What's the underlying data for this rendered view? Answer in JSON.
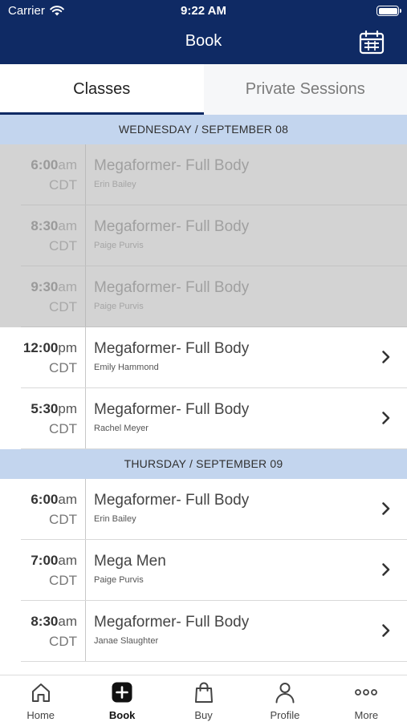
{
  "status_bar": {
    "carrier": "Carrier",
    "time": "9:22 AM"
  },
  "navbar": {
    "title": "Book"
  },
  "tabs": [
    {
      "label": "Classes",
      "active": true
    },
    {
      "label": "Private Sessions",
      "active": false
    }
  ],
  "days": [
    {
      "header": "WEDNESDAY / SEPTEMBER 08",
      "classes": [
        {
          "time": "6:00",
          "ampm": "am",
          "tz": "CDT",
          "name": "Megaformer- Full Body",
          "instructor": "Erin Bailey",
          "past": true
        },
        {
          "time": "8:30",
          "ampm": "am",
          "tz": "CDT",
          "name": "Megaformer- Full Body",
          "instructor": "Paige Purvis",
          "past": true
        },
        {
          "time": "9:30",
          "ampm": "am",
          "tz": "CDT",
          "name": "Megaformer- Full Body",
          "instructor": "Paige Purvis",
          "past": true
        },
        {
          "time": "12:00",
          "ampm": "pm",
          "tz": "CDT",
          "name": "Megaformer- Full Body",
          "instructor": "Emily Hammond",
          "past": false
        },
        {
          "time": "5:30",
          "ampm": "pm",
          "tz": "CDT",
          "name": "Megaformer- Full Body",
          "instructor": "Rachel Meyer",
          "past": false
        }
      ]
    },
    {
      "header": "THURSDAY / SEPTEMBER 09",
      "classes": [
        {
          "time": "6:00",
          "ampm": "am",
          "tz": "CDT",
          "name": "Megaformer- Full Body",
          "instructor": "Erin Bailey",
          "past": false
        },
        {
          "time": "7:00",
          "ampm": "am",
          "tz": "CDT",
          "name": "Mega Men",
          "instructor": "Paige Purvis",
          "past": false
        },
        {
          "time": "8:30",
          "ampm": "am",
          "tz": "CDT",
          "name": "Megaformer- Full Body",
          "instructor": "Janae Slaughter",
          "past": false
        }
      ]
    }
  ],
  "tabbar": [
    {
      "label": "Home",
      "icon": "home-icon",
      "active": false
    },
    {
      "label": "Book",
      "icon": "book-plus-icon",
      "active": true
    },
    {
      "label": "Buy",
      "icon": "shopping-bag-icon",
      "active": false
    },
    {
      "label": "Profile",
      "icon": "profile-icon",
      "active": false
    },
    {
      "label": "More",
      "icon": "more-icon",
      "active": false
    }
  ],
  "colors": {
    "brand": "#0f2a64",
    "day_header_bg": "#c3d5ee",
    "past_row_bg": "#d3d3d3"
  }
}
